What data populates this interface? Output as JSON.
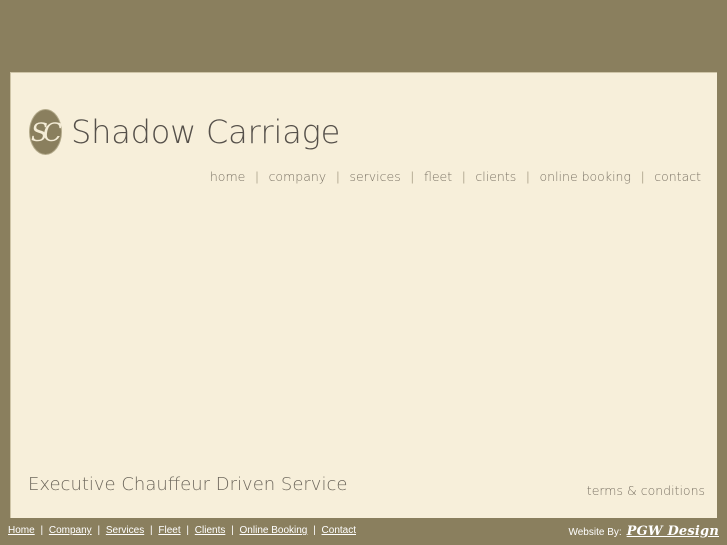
{
  "theme": {
    "background_tan": "#8a7f5e",
    "panel_cream": "#f7efda",
    "panel_border": "#cfc5a8",
    "logo_text_color": "#55504a",
    "nav_text_color": "#7b7365",
    "footer_text_color": "#ffffff"
  },
  "header": {
    "logo": {
      "monogram": "SC",
      "brand_name": "Shadow Carriage"
    },
    "nav": {
      "separator": "|",
      "items": [
        {
          "label": "home"
        },
        {
          "label": "company"
        },
        {
          "label": "services"
        },
        {
          "label": "fleet"
        },
        {
          "label": "clients"
        },
        {
          "label": "online booking"
        },
        {
          "label": "contact"
        }
      ]
    }
  },
  "main": {
    "tagline": "Executive Chauffeur Driven Service",
    "terms_link": "terms & conditions"
  },
  "footer": {
    "separator": "|",
    "links": [
      {
        "label": "Home"
      },
      {
        "label": "Company"
      },
      {
        "label": "Services"
      },
      {
        "label": "Fleet"
      },
      {
        "label": "Clients"
      },
      {
        "label": "Online Booking"
      },
      {
        "label": "Contact"
      }
    ],
    "credit_label": "Website By:",
    "credit_brand": "PGW Design"
  }
}
